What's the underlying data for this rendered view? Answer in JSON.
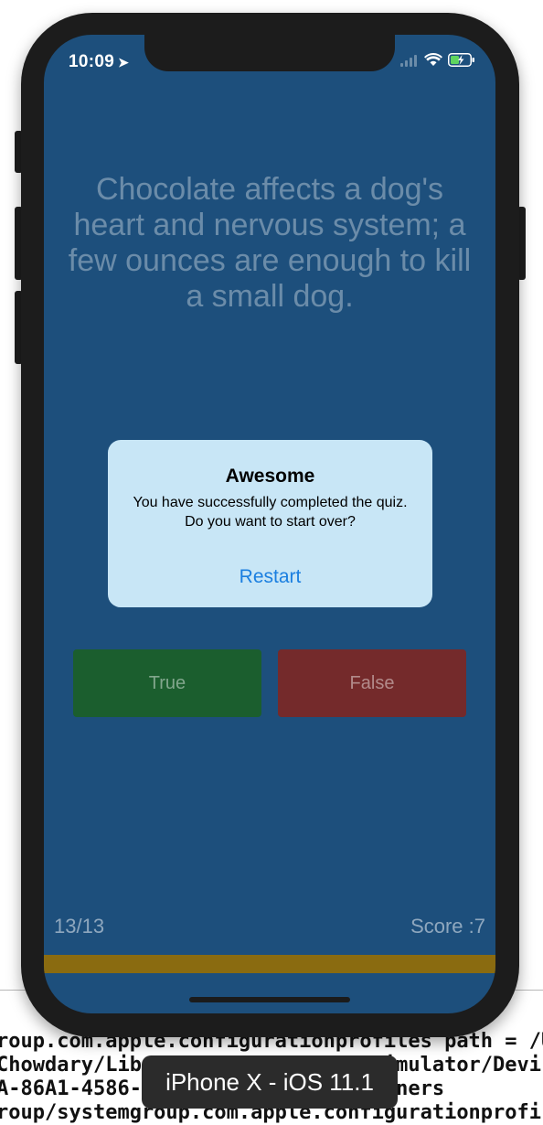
{
  "status_bar": {
    "time": "10:09"
  },
  "quiz": {
    "question": "Chocolate affects a dog's heart and nervous system; a few ounces are enough to kill a small dog.",
    "true_label": "True",
    "false_label": "False",
    "question_counter": "13/13",
    "score": "Score :7",
    "progress": 1.0
  },
  "alert": {
    "title": "Awesome",
    "message": "You have successfully completed the quiz. Do you want to start over?",
    "action_label": "Restart"
  },
  "simulator": {
    "device_label": "iPhone X - iOS 11.1",
    "console_lines": [
      "roup.com.apple.configurationprofiles path = /U",
      "Chowdary/Library/Developer/CoreSimulator/Devi",
      "A-86A1-4586-         /data/Containers",
      "roup/systemgroup.com.apple.configurationprofi"
    ]
  },
  "colors": {
    "background": "#1d4f7c",
    "true_button": "#1b5e2e",
    "false_button": "#742a2b",
    "progress_bar": "#8a6b10",
    "alert_background": "#c8e6f6",
    "alert_action": "#1b7fe0"
  },
  "icons": {
    "location": "location-arrow-icon",
    "signal": "cellular-signal-icon",
    "wifi": "wifi-icon",
    "battery": "battery-charging-icon"
  }
}
